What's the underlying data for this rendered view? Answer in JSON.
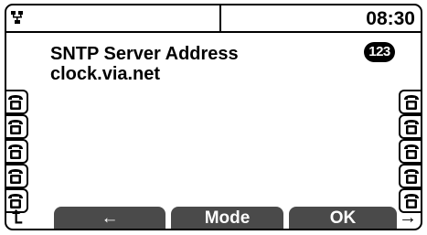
{
  "status": {
    "network_icon": "network-icon",
    "clock": "08:30"
  },
  "screen": {
    "title": "SNTP Server Address",
    "value": "clock.via.net",
    "input_mode_badge": "123"
  },
  "line_keys": {
    "left_count": 5,
    "right_count": 5,
    "icon": "phone-handset-icon"
  },
  "softkeys": {
    "left_edge_arrow": "⮤",
    "key1_label": "←",
    "key2_label": "Mode",
    "key3_label": "OK",
    "right_edge_arrow": "→"
  },
  "colors": {
    "softkey_bg": "#4a4a4a",
    "foreground": "#000000",
    "background": "#ffffff"
  }
}
